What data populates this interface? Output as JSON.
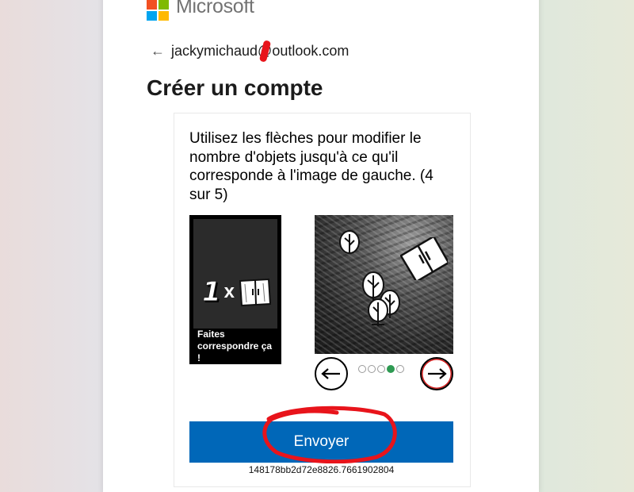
{
  "brand": {
    "name": "Microsoft"
  },
  "header": {
    "back_icon": "back-arrow-icon",
    "email": "jackymichaud@outlook.com"
  },
  "title": "Créer un compte",
  "challenge": {
    "instruction": "Utilisez les flèches pour modifier le nombre d'objets jusqu'à ce qu'il corresponde à l'image de gauche. (4 sur 5)",
    "target_count": "1",
    "multiplier": "x",
    "target_label": "Faites correspondre ça !",
    "pager": {
      "total": 5,
      "active": 4
    },
    "prev_icon": "arrow-left-icon",
    "next_icon": "arrow-right-icon"
  },
  "submit_label": "Envoyer",
  "session_id": "148178bb2d72e8826.7661902804",
  "colors": {
    "primary": "#0067b8",
    "pager_active": "#2e9a52",
    "annotation": "#e8141b"
  }
}
